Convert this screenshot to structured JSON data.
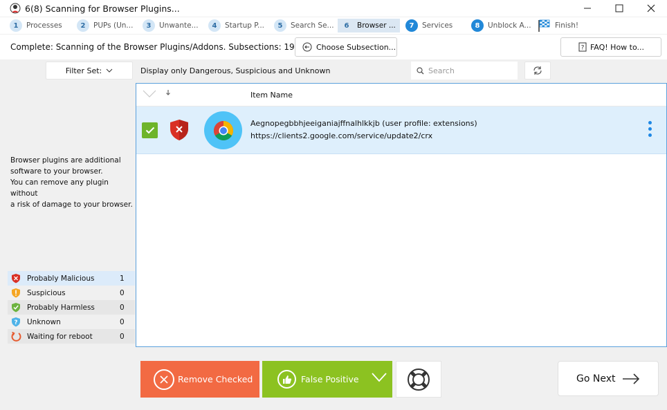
{
  "window": {
    "title": "6(8) Scanning for Browser Plugins..."
  },
  "steps": [
    {
      "num": "1",
      "label": "Processes"
    },
    {
      "num": "2",
      "label": "PUPs (Un..."
    },
    {
      "num": "3",
      "label": "Unwante..."
    },
    {
      "num": "4",
      "label": "Startup P..."
    },
    {
      "num": "5",
      "label": "Search Se..."
    },
    {
      "num": "6",
      "label": "Browser ..."
    },
    {
      "num": "7",
      "label": "Services"
    },
    {
      "num": "8",
      "label": "Unblock A..."
    },
    {
      "num": "",
      "label": "Finish!"
    }
  ],
  "header": {
    "complete_text": "Complete: Scanning of the Browser Plugins/Addons. Subsections: 19",
    "choose_subsection": "Choose Subsection...",
    "faq": "FAQ! How to..."
  },
  "filterbar": {
    "filter_set": "Filter Set:",
    "display_only": "Display only Dangerous, Suspicious and Unknown",
    "search_placeholder": "Search"
  },
  "left_panel": {
    "description_lines": [
      "Browser plugins are additional",
      "software to your browser.",
      "You can remove any plugin without",
      "a risk of damage to your browser."
    ],
    "stats": [
      {
        "label": "Probably Malicious",
        "count": "1",
        "icon": "shield-x-icon",
        "color": "#d93025"
      },
      {
        "label": "Suspicious",
        "count": "0",
        "icon": "shield-exclamation-icon",
        "color": "#f5a623"
      },
      {
        "label": "Probably Harmless",
        "count": "0",
        "icon": "shield-check-icon",
        "color": "#6db33f"
      },
      {
        "label": "Unknown",
        "count": "0",
        "icon": "shield-question-icon",
        "color": "#4fb3e8"
      },
      {
        "label": "Waiting for reboot",
        "count": "0",
        "icon": "reboot-icon",
        "color": "#e65a2e"
      }
    ]
  },
  "table": {
    "column_item_name": "Item Name",
    "rows": [
      {
        "name": "Aegnopegbbhjeeiganiajffnalhlkkjb (user profile: extensions)",
        "url": "https://clients2.google.com/service/update2/crx",
        "checked": true,
        "status": "Probably Malicious",
        "icon": "chrome-icon"
      }
    ]
  },
  "bottom": {
    "remove_checked": "Remove Checked",
    "false_positive": "False Positive",
    "go_next": "Go Next"
  },
  "colors": {
    "remove": "#f26a43",
    "false_positive": "#8cc221",
    "accent": "#2188d8"
  }
}
